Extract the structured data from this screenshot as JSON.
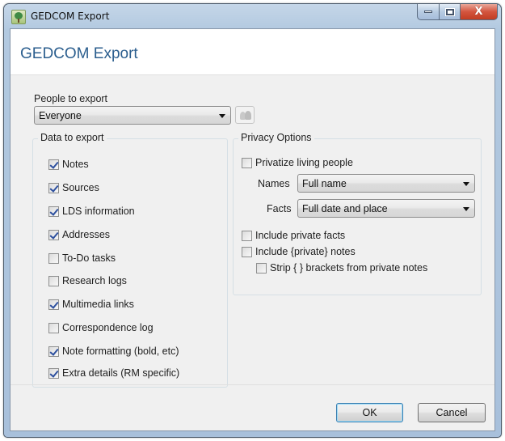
{
  "window": {
    "title": "GEDCOM Export",
    "app_icon": "family-tree-icon",
    "caption_buttons": {
      "minimize": "minimize-icon",
      "maximize": "maximize-icon",
      "close_glyph": "X"
    }
  },
  "header": {
    "title": "GEDCOM Export"
  },
  "people": {
    "label": "People to export",
    "selected": "Everyone",
    "picker_icon": "people-icon"
  },
  "data_to_export": {
    "title": "Data to export",
    "items": [
      {
        "label": "Notes",
        "checked": true
      },
      {
        "label": "Sources",
        "checked": true
      },
      {
        "label": "LDS information",
        "checked": true
      },
      {
        "label": "Addresses",
        "checked": true
      },
      {
        "label": "To-Do tasks",
        "checked": false
      },
      {
        "label": "Research logs",
        "checked": false
      },
      {
        "label": "Multimedia links",
        "checked": true
      },
      {
        "label": "Correspondence log",
        "checked": false
      },
      {
        "label": "Note formatting (bold, etc)",
        "checked": true
      },
      {
        "label": "Extra details (RM specific)",
        "checked": true
      }
    ]
  },
  "privacy": {
    "title": "Privacy Options",
    "privatize_living": {
      "label": "Privatize living people",
      "checked": false
    },
    "names": {
      "label": "Names",
      "selected": "Full name"
    },
    "facts": {
      "label": "Facts",
      "selected": "Full date and place"
    },
    "include_private_facts": {
      "label": "Include private facts",
      "checked": false
    },
    "include_private_notes": {
      "label": "Include {private} notes",
      "checked": false
    },
    "strip_brackets": {
      "label": "Strip { } brackets from private notes",
      "checked": false
    }
  },
  "buttons": {
    "ok": "OK",
    "cancel": "Cancel"
  }
}
